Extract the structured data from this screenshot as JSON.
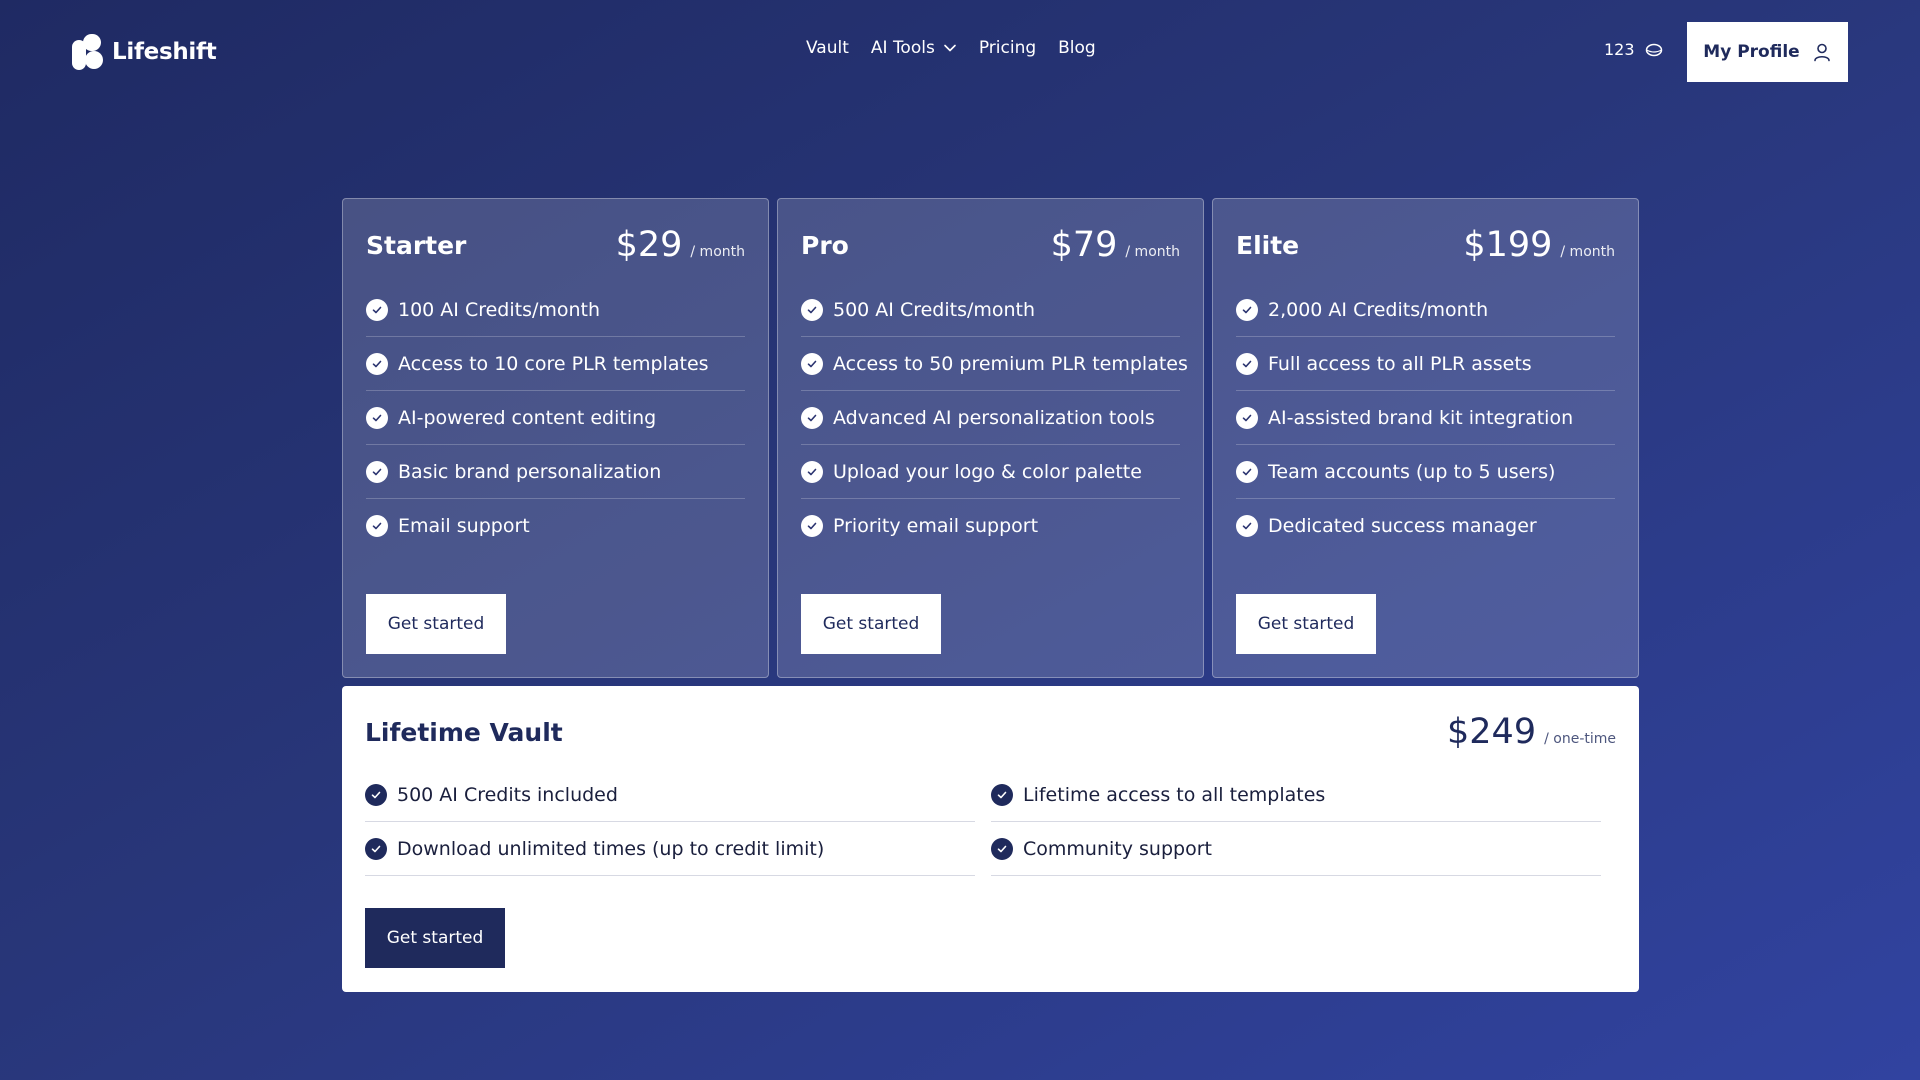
{
  "header": {
    "logo_text": "Lifeshift",
    "logo_icon": "lifeshift-logo-icon",
    "nav": [
      {
        "label": "Vault"
      },
      {
        "label": "AI Tools",
        "icon": "chevron-down-icon"
      },
      {
        "label": "Pricing"
      },
      {
        "label": "Blog"
      }
    ],
    "credits": "123",
    "credits_icon": "coin-icon",
    "profile_label": "My Profile",
    "profile_icon": "user-icon"
  },
  "plans": [
    {
      "name": "Starter",
      "price": "$29",
      "period": "/ month",
      "features": [
        "100 AI Credits/month",
        "Access to 10 core PLR templates",
        "AI-powered content editing",
        "Basic brand personalization",
        "Email support"
      ],
      "cta": "Get started"
    },
    {
      "name": "Pro",
      "price": "$79",
      "period": "/ month",
      "features": [
        "500 AI Credits/month",
        "Access to 50 premium PLR templates",
        "Advanced AI personalization tools",
        "Upload your logo & color palette",
        "Priority email support"
      ],
      "cta": "Get started"
    },
    {
      "name": "Elite",
      "price": "$199",
      "period": "/ month",
      "features": [
        "2,000 AI Credits/month",
        "Full access to all PLR assets",
        "AI-assisted brand kit integration",
        "Team accounts (up to 5 users)",
        "Dedicated success manager"
      ],
      "cta": "Get started"
    }
  ],
  "lifetime": {
    "name": "Lifetime Vault",
    "price": "$249",
    "period": "/ one-time",
    "features": [
      "500 AI Credits included",
      "Lifetime access to all templates",
      "Download unlimited times (up to credit limit)",
      "Community support"
    ],
    "cta": "Get started"
  },
  "colors": {
    "background_start": "#1f2a63",
    "background_end": "#3143a0",
    "brand_dark": "#1f2a5c",
    "card_text": "#ffffff"
  }
}
